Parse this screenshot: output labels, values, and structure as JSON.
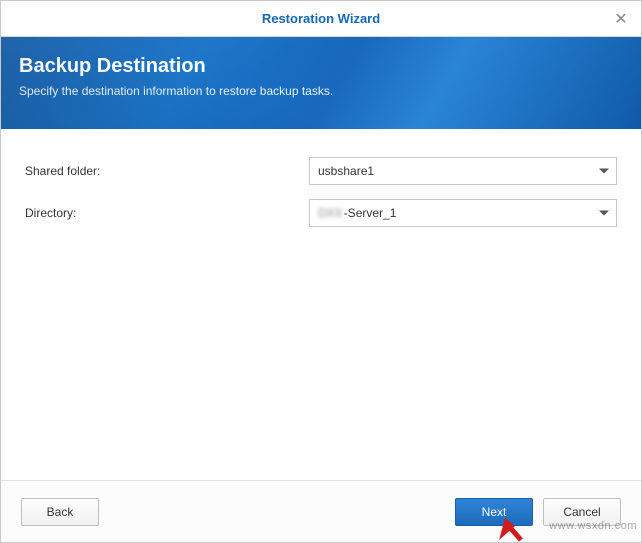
{
  "window": {
    "title": "Restoration Wizard"
  },
  "banner": {
    "heading": "Backup Destination",
    "subheading": "Specify the destination information to restore backup tasks."
  },
  "form": {
    "shared_folder_label": "Shared folder:",
    "shared_folder_value": "usbshare1",
    "directory_label": "Directory:",
    "directory_value_suffix": "-Server_1"
  },
  "buttons": {
    "back": "Back",
    "next": "Next",
    "cancel": "Cancel"
  },
  "watermark": "www.wsxdn.com"
}
